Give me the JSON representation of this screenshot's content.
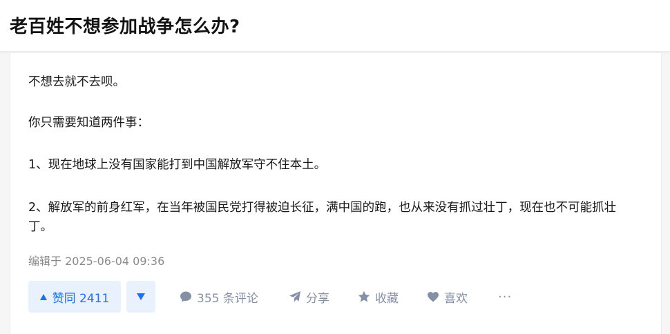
{
  "question": {
    "title": "老百姓不想参加战争怎么办?"
  },
  "answer": {
    "paragraphs": [
      "不想去就不去呗。",
      "你只需要知道两件事：",
      "1、现在地球上没有国家能打到中国解放军守不住本土。",
      "2、解放军的前身红军，在当年被国民党打得被迫长征，满中国的跑，也从来没有抓过壮丁，现在也不可能抓壮丁。"
    ],
    "edited_label": "编辑于 2025-06-04 09:36"
  },
  "actions": {
    "vote_up_label": "赞同 2411",
    "comments_label": "355 条评论",
    "share_label": "分享",
    "collect_label": "收藏",
    "like_label": "喜欢",
    "more_label": "···"
  },
  "icons": {
    "vote_up": "triangle-up-icon",
    "vote_down": "triangle-down-icon",
    "comment": "comment-bubble-icon",
    "share": "paper-plane-icon",
    "collect": "star-icon",
    "like": "heart-icon",
    "more": "ellipsis-icon"
  },
  "colors": {
    "accent": "#1772f6",
    "vote_bg": "#e9f1fc",
    "muted": "#8590a6",
    "meta": "#8a8a8a"
  }
}
